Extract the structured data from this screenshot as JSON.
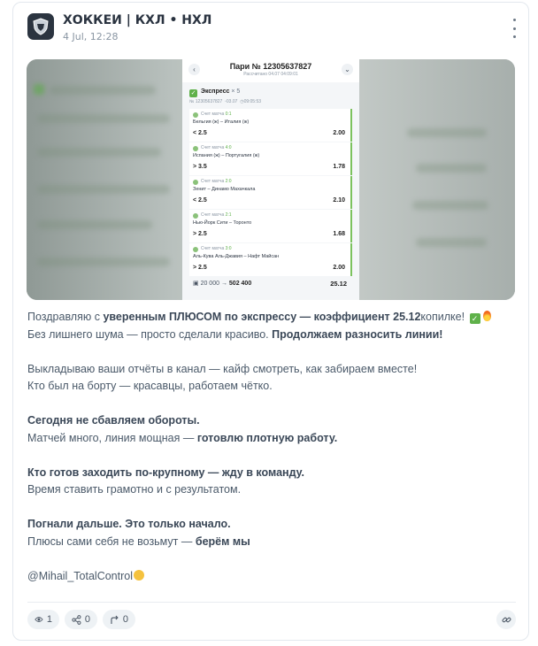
{
  "post": {
    "channel_name": "ХОККЕИ | КХЛ • НХЛ",
    "date": "4 Jul, 12:28"
  },
  "bet_slip": {
    "title": "Пари № 12305637827",
    "calculated": "Рассчитано 04.07 04:09:01",
    "express_label": "Экспресс",
    "express_count": "× 5",
    "meta_id": "№ 12305637827",
    "meta_date": "03.07",
    "meta_time": "09:05:53",
    "legs": [
      {
        "score_label": "Счет матча",
        "score": "0:1",
        "match": "Бельгия (ж) – Италия (ж)",
        "pick": "< 2.5",
        "odds": "2.00"
      },
      {
        "score_label": "Счет матча",
        "score": "4:0",
        "match": "Испания (ж) – Португалия (ж)",
        "pick": "> 3.5",
        "odds": "1.78"
      },
      {
        "score_label": "Счет матча",
        "score": "2:0",
        "match": "Зенит – Динамо Махачкала",
        "pick": "< 2.5",
        "odds": "2.10"
      },
      {
        "score_label": "Счет матча",
        "score": "2:1",
        "match": "Нью-Йорк Сити – Торонто",
        "pick": "> 2.5",
        "odds": "1.68"
      },
      {
        "score_label": "Счет матча",
        "score": "3:0",
        "match": "Аль-Кува Аль-Джавия – Нафт Майсан",
        "pick": "> 2.5",
        "odds": "2.00"
      }
    ],
    "stake": "20 000",
    "arrow": "→",
    "payout": "502 400",
    "total_odds": "25.12"
  },
  "message": {
    "l1_a": "Поздравляю с ",
    "l1_b": "уверенным ПЛЮСОМ по экспрессу — коэффициент 25.12",
    "l1_c": "копилке!",
    "l2_a": "Без лишнего шума — просто сделали красиво. ",
    "l2_b": "Продолжаем разносить линии!",
    "l3": "Выкладываю ваши отчёты в канал — кайф смотреть, как забираем вместе!",
    "l4": "Кто был на борту — красавцы, работаем чётко.",
    "l5": "Сегодня не сбавляем обороты.",
    "l6_a": "Матчей много, линия мощная — ",
    "l6_b": "готовлю плотную работу.",
    "l7": "Кто готов заходить по-крупному — жду в команду.",
    "l8": "Время ставить грамотно и с результатом.",
    "l9": "Погнали дальше. Это только начало.",
    "l10_a": "Плюсы сами себя не возьмут — ",
    "l10_b": "берём мы",
    "signature": "@Mihail_TotalControl"
  },
  "actions": {
    "views": "1",
    "shares": "0",
    "forwards": "0"
  },
  "icons": {
    "views": "eye-icon",
    "shares": "share-icon",
    "forwards": "forward-arrow-icon",
    "link": "link-icon",
    "menu": "kebab-menu-icon"
  },
  "colors": {
    "accent_green": "#5fb14a",
    "text": "#4a5969",
    "pill_bg": "#eef2f5"
  }
}
